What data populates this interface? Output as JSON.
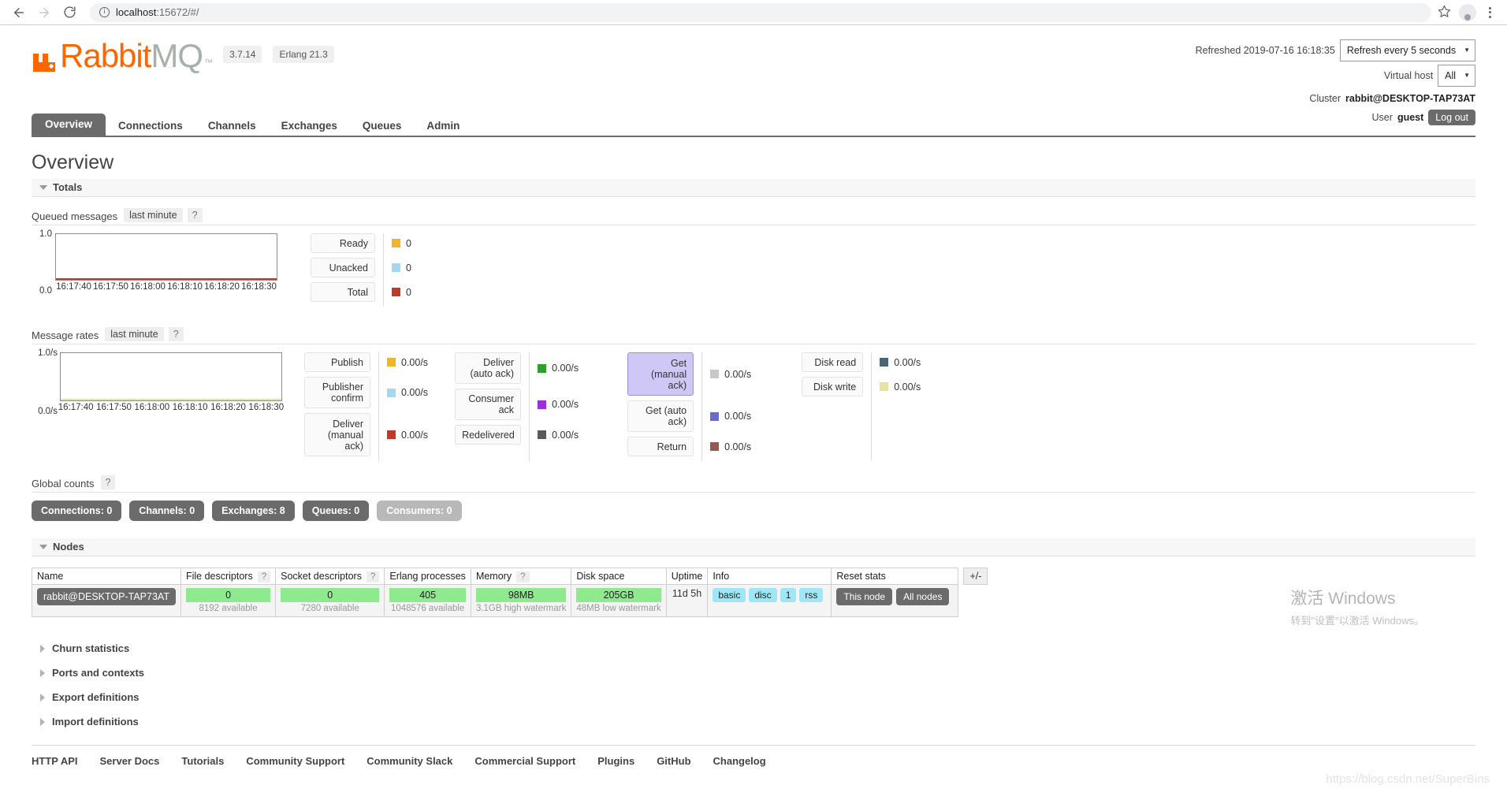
{
  "browser": {
    "url_host": "localhost",
    "url_rest": ":15672/#/",
    "back_icon": "back-arrow-icon",
    "forward_icon": "forward-arrow-icon",
    "reload_icon": "reload-icon",
    "info_icon": "site-info-icon",
    "star_icon": "bookmark-star-icon",
    "profile_icon": "profile-avatar-icon",
    "menu_icon": "chrome-menu-icon"
  },
  "header": {
    "logo_rabbit": "Rabbit",
    "logo_mq": "MQ",
    "logo_tm": "™",
    "version": "3.7.14",
    "erlang": "Erlang 21.3",
    "refreshed_label": "Refreshed 2019-07-16 16:18:35",
    "refresh_select": "Refresh every 5 seconds",
    "vhost_label": "Virtual host",
    "vhost_select": "All",
    "cluster_label": "Cluster",
    "cluster_name": "rabbit@DESKTOP-TAP73AT",
    "user_label": "User",
    "user_name": "guest",
    "logout_label": "Log out"
  },
  "tabs": [
    {
      "label": "Overview",
      "active": true
    },
    {
      "label": "Connections",
      "active": false
    },
    {
      "label": "Channels",
      "active": false
    },
    {
      "label": "Exchanges",
      "active": false
    },
    {
      "label": "Queues",
      "active": false
    },
    {
      "label": "Admin",
      "active": false
    }
  ],
  "page_title": "Overview",
  "totals": {
    "section_label": "Totals",
    "queued": {
      "label": "Queued messages",
      "period": "last minute",
      "help": "?"
    },
    "rates": {
      "label": "Message rates",
      "period": "last minute",
      "help": "?"
    }
  },
  "chart_data": [
    {
      "type": "line",
      "title": "Queued messages",
      "subtitle": "last minute",
      "ylabel": "",
      "xlabel": "",
      "ylim": [
        0.0,
        1.0
      ],
      "ytick_labels": [
        "1.0",
        "0.0"
      ],
      "xtick_labels": [
        "16:17:40",
        "16:17:50",
        "16:18:00",
        "16:18:10",
        "16:18:20",
        "16:18:30"
      ],
      "grid": false,
      "legend_position": "right",
      "series": [
        {
          "name": "Ready",
          "color": "#edb62c",
          "value": "0",
          "values": [
            0,
            0,
            0,
            0,
            0,
            0
          ]
        },
        {
          "name": "Unacked",
          "color": "#a6d7f0",
          "value": "0",
          "values": [
            0,
            0,
            0,
            0,
            0,
            0
          ]
        },
        {
          "name": "Total",
          "color": "#c0392b",
          "value": "0",
          "values": [
            0,
            0,
            0,
            0,
            0,
            0
          ]
        }
      ]
    },
    {
      "type": "line",
      "title": "Message rates",
      "subtitle": "last minute",
      "ylabel": "",
      "xlabel": "",
      "ylim": [
        0.0,
        1.0
      ],
      "ytick_labels": [
        "1.0/s",
        "0.0/s"
      ],
      "xtick_labels": [
        "16:17:40",
        "16:17:50",
        "16:18:00",
        "16:18:10",
        "16:18:20",
        "16:18:30"
      ],
      "grid": false,
      "legend_position": "right",
      "series": [
        {
          "name": "Publish",
          "color": "#edb62c",
          "value": "0.00/s",
          "values": [
            0,
            0,
            0,
            0,
            0,
            0
          ]
        },
        {
          "name": "Publisher confirm",
          "color": "#a6d7f0",
          "value": "0.00/s",
          "values": [
            0,
            0,
            0,
            0,
            0,
            0
          ]
        },
        {
          "name": "Deliver (manual ack)",
          "color": "#c0392b",
          "value": "0.00/s",
          "values": [
            0,
            0,
            0,
            0,
            0,
            0
          ]
        },
        {
          "name": "Deliver (auto ack)",
          "color": "#2ca02c",
          "value": "0.00/s",
          "values": [
            0,
            0,
            0,
            0,
            0,
            0
          ]
        },
        {
          "name": "Consumer ack",
          "color": "#9b30d9",
          "value": "0.00/s",
          "values": [
            0,
            0,
            0,
            0,
            0,
            0
          ]
        },
        {
          "name": "Redelivered",
          "color": "#5a5a5a",
          "value": "0.00/s",
          "values": [
            0,
            0,
            0,
            0,
            0,
            0
          ]
        },
        {
          "name": "Get (manual ack)",
          "color": "#c8c8c8",
          "value": "0.00/s",
          "values": [
            0,
            0,
            0,
            0,
            0,
            0
          ]
        },
        {
          "name": "Get (auto ack)",
          "color": "#6a6ad0",
          "value": "0.00/s",
          "values": [
            0,
            0,
            0,
            0,
            0,
            0
          ]
        },
        {
          "name": "Return",
          "color": "#96594f",
          "value": "0.00/s",
          "values": [
            0,
            0,
            0,
            0,
            0,
            0
          ]
        },
        {
          "name": "Disk read",
          "color": "#4a6575",
          "value": "0.00/s",
          "values": [
            0,
            0,
            0,
            0,
            0,
            0
          ]
        },
        {
          "name": "Disk write",
          "color": "#e6e2a8",
          "value": "0.00/s",
          "values": [
            0,
            0,
            0,
            0,
            0,
            0
          ]
        }
      ]
    }
  ],
  "queued_legend": [
    {
      "label": "Ready",
      "value": "0",
      "color": "#edb62c",
      "selected": false
    },
    {
      "label": "Unacked",
      "value": "0",
      "color": "#a6d7f0",
      "selected": false
    },
    {
      "label": "Total",
      "value": "0",
      "color": "#c0392b",
      "selected": false
    }
  ],
  "rates_legend_groups": [
    {
      "items": [
        {
          "label": "Publish",
          "value": "0.00/s",
          "color": "#edb62c",
          "selected": false
        },
        {
          "label": "Publisher\nconfirm",
          "value": "0.00/s",
          "color": "#a6d7f0",
          "selected": false
        },
        {
          "label": "Deliver\n(manual\nack)",
          "value": "0.00/s",
          "color": "#c0392b",
          "selected": false
        }
      ]
    },
    {
      "items": [
        {
          "label": "Deliver\n(auto ack)",
          "value": "0.00/s",
          "color": "#2ca02c",
          "selected": false
        },
        {
          "label": "Consumer\nack",
          "value": "0.00/s",
          "color": "#9b30d9",
          "selected": false
        },
        {
          "label": "Redelivered",
          "value": "0.00/s",
          "color": "#5a5a5a",
          "selected": false
        }
      ]
    },
    {
      "items": [
        {
          "label": "Get\n(manual\nack)",
          "value": "0.00/s",
          "color": "#c8c8c8",
          "selected": true
        },
        {
          "label": "Get (auto\nack)",
          "value": "0.00/s",
          "color": "#6a6ad0",
          "selected": false
        },
        {
          "label": "Return",
          "value": "0.00/s",
          "color": "#96594f",
          "selected": false
        }
      ]
    },
    {
      "items": [
        {
          "label": "Disk read",
          "value": "0.00/s",
          "color": "#4a6575",
          "selected": false
        },
        {
          "label": "Disk write",
          "value": "0.00/s",
          "color": "#e6e2a8",
          "selected": false
        }
      ]
    }
  ],
  "global_counts": {
    "label": "Global counts",
    "help": "?",
    "badges": [
      {
        "label": "Connections: 0",
        "muted": false
      },
      {
        "label": "Channels: 0",
        "muted": false
      },
      {
        "label": "Exchanges: 8",
        "muted": false
      },
      {
        "label": "Queues: 0",
        "muted": false
      },
      {
        "label": "Consumers: 0",
        "muted": true
      }
    ]
  },
  "nodes": {
    "section_label": "Nodes",
    "columns": [
      {
        "label": "Name",
        "help": ""
      },
      {
        "label": "File descriptors",
        "help": "?"
      },
      {
        "label": "Socket descriptors",
        "help": "?"
      },
      {
        "label": "Erlang processes",
        "help": ""
      },
      {
        "label": "Memory",
        "help": "?"
      },
      {
        "label": "Disk space",
        "help": ""
      },
      {
        "label": "Uptime",
        "help": ""
      },
      {
        "label": "Info",
        "help": ""
      },
      {
        "label": "Reset stats",
        "help": ""
      }
    ],
    "plusminus": "+/-",
    "row": {
      "name": "rabbit@DESKTOP-TAP73AT",
      "file_descriptors": {
        "value": "0",
        "sub": "8192 available"
      },
      "socket_descriptors": {
        "value": "0",
        "sub": "7280 available"
      },
      "erlang_processes": {
        "value": "405",
        "sub": "1048576 available"
      },
      "memory": {
        "value": "98MB",
        "sub": "3.1GB high watermark"
      },
      "disk_space": {
        "value": "205GB",
        "sub": "48MB low watermark"
      },
      "uptime": "11d 5h",
      "info_chips": [
        "basic",
        "disc",
        "1",
        "rss"
      ],
      "reset_buttons": [
        "This node",
        "All nodes"
      ]
    }
  },
  "collapsibles": [
    {
      "label": "Churn statistics"
    },
    {
      "label": "Ports and contexts"
    },
    {
      "label": "Export definitions"
    },
    {
      "label": "Import definitions"
    }
  ],
  "footer_links": [
    "HTTP API",
    "Server Docs",
    "Tutorials",
    "Community Support",
    "Community Slack",
    "Commercial Support",
    "Plugins",
    "GitHub",
    "Changelog"
  ],
  "watermarks": {
    "windows_title": "激活 Windows",
    "windows_sub": "转到\"设置\"以激活 Windows。",
    "blog": "https://blog.csdn.net/SuperBins"
  }
}
